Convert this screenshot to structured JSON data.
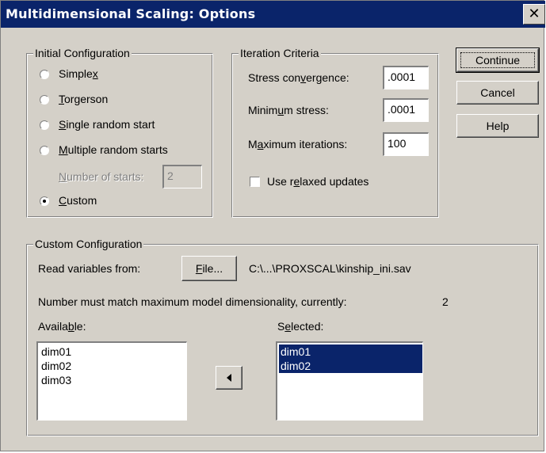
{
  "window": {
    "title": "Multidimensional Scaling: Options",
    "close_glyph": "✕"
  },
  "initial_configuration": {
    "legend": "Initial Configuration",
    "options": [
      {
        "label": "Simplex",
        "checked": false
      },
      {
        "label": "Torgerson",
        "checked": false
      },
      {
        "label": "Single random start",
        "checked": false
      },
      {
        "label": "Multiple random starts",
        "checked": false
      },
      {
        "label": "Custom",
        "checked": true
      }
    ],
    "number_of_starts_label": "Number of starts:",
    "number_of_starts_value": "2"
  },
  "iteration_criteria": {
    "legend": "Iteration Criteria",
    "stress_convergence_label": "Stress convergence:",
    "stress_convergence_value": ".0001",
    "minimum_stress_label": "Minimum stress:",
    "minimum_stress_value": ".0001",
    "maximum_iterations_label": "Maximum iterations:",
    "maximum_iterations_value": "100",
    "relaxed_updates_label": "Use relaxed updates",
    "relaxed_updates_checked": false
  },
  "buttons": {
    "continue": "Continue",
    "cancel": "Cancel",
    "help": "Help"
  },
  "custom_configuration": {
    "legend": "Custom Configuration",
    "read_variables_label": "Read variables from:",
    "file_button": "File...",
    "file_path": "C:\\...\\PROXSCAL\\kinship_ini.sav",
    "dimensionality_note": "Number must match maximum model dimensionality, currently:",
    "dimensionality_value": "2",
    "available_label": "Available:",
    "available_items": [
      "dim01",
      "dim02",
      "dim03"
    ],
    "selected_label": "Selected:",
    "selected_items": [
      "dim01",
      "dim02"
    ]
  }
}
